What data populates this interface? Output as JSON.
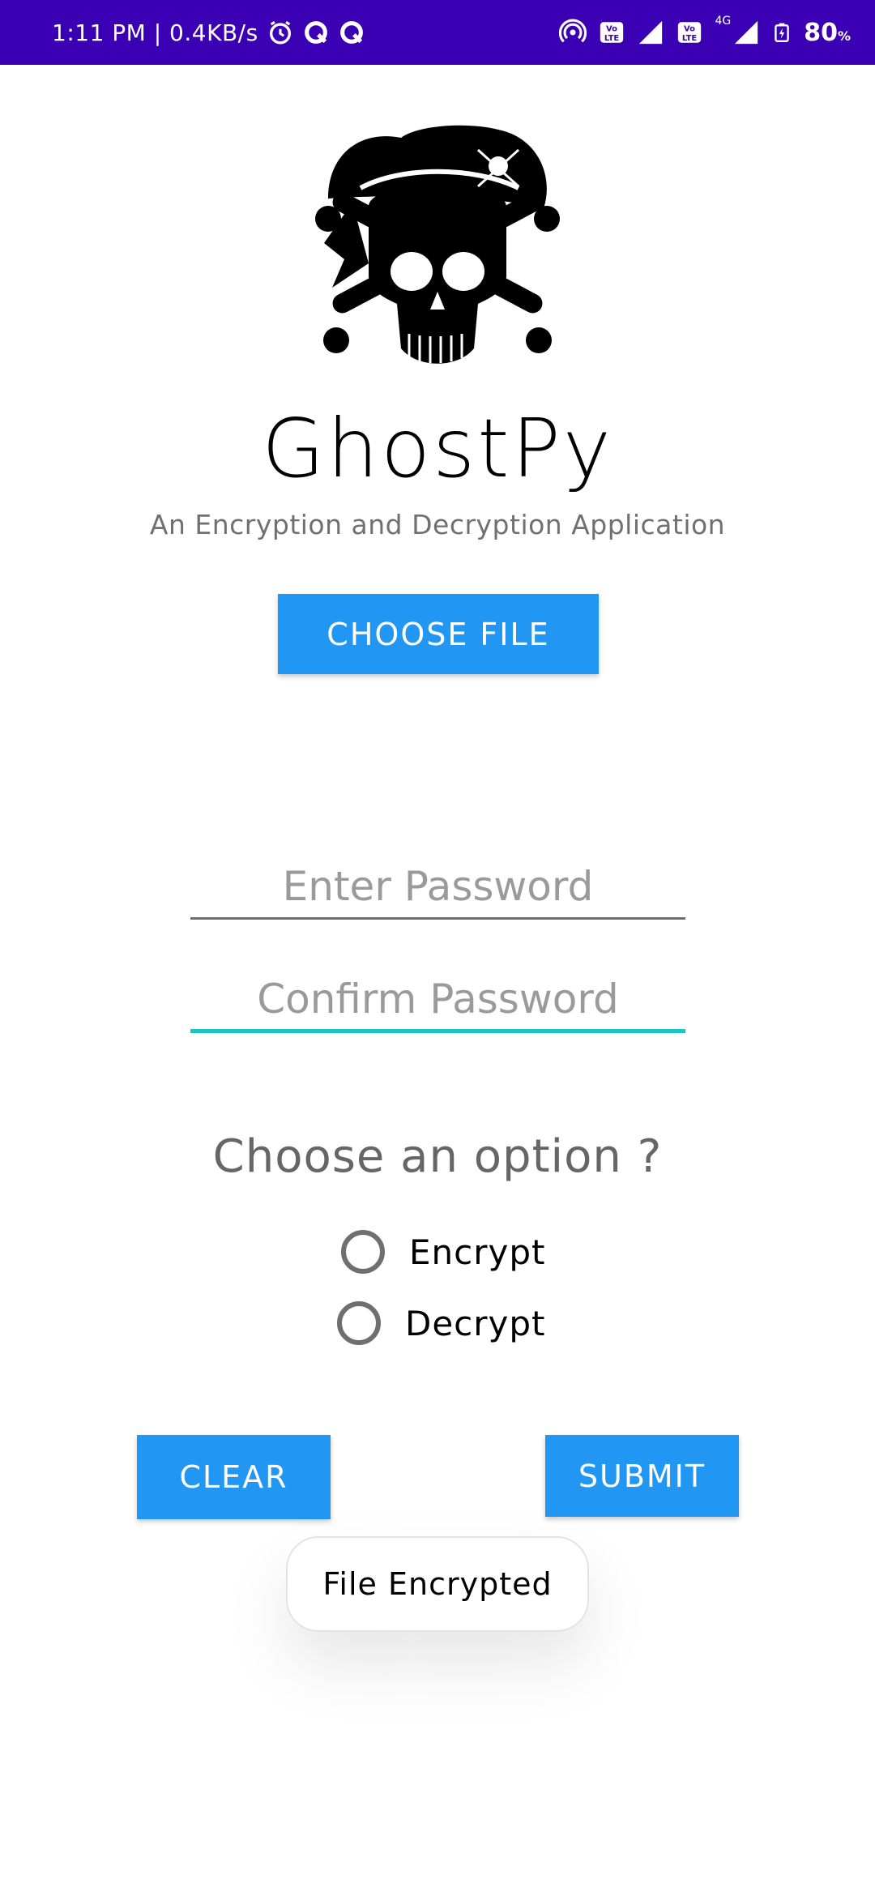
{
  "status_bar": {
    "time": "1:11 PM | 0.4KB/s",
    "battery_percent": "80",
    "battery_unit": "%",
    "network": "4G",
    "volte_label": "Vo\nLTE",
    "background": "#3c00b4",
    "icons": [
      "alarm-icon",
      "q-app-icon",
      "q-app-icon",
      "hotspot-icon",
      "volte-icon",
      "signal-icon",
      "volte-icon",
      "signal-icon",
      "battery-charging-icon"
    ]
  },
  "app": {
    "title": "GhostPy",
    "subtitle": "An Encryption and Decryption Application",
    "logo_icon": "pirate-skull-logo"
  },
  "actions": {
    "choose_file_label": "CHOOSE FILE",
    "clear_label": "CLEAR",
    "submit_label": "SUBMIT",
    "button_color": "#2196f3"
  },
  "form": {
    "password_placeholder": "Enter Password",
    "password_value": "",
    "confirm_placeholder": "Confirm Password",
    "confirm_value": "",
    "focus_color": "#1ec4c4"
  },
  "options": {
    "prompt": "Choose an option ?",
    "items": [
      {
        "label": "Encrypt",
        "selected": false
      },
      {
        "label": "Decrypt",
        "selected": false
      }
    ]
  },
  "toast": {
    "message": "File Encrypted"
  }
}
